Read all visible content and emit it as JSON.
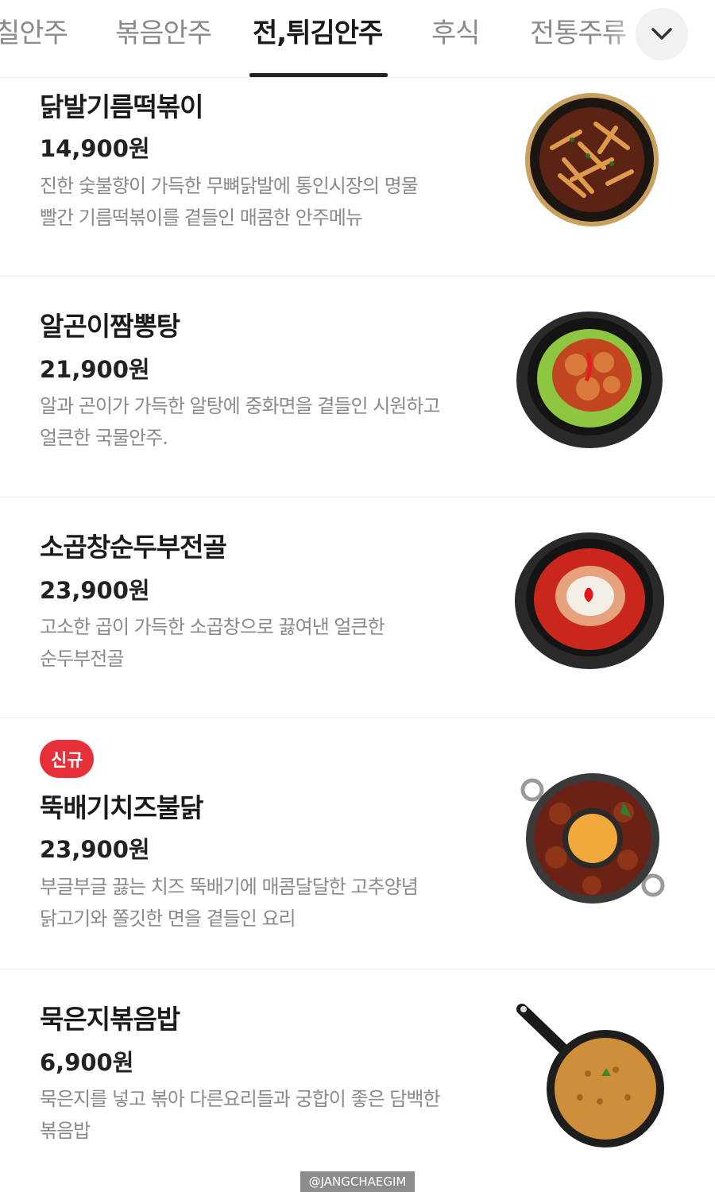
{
  "tabs": [
    {
      "label": "칠안주",
      "active": false
    },
    {
      "label": "볶음안주",
      "active": false
    },
    {
      "label": "전,튀김안주",
      "active": true
    },
    {
      "label": "후식",
      "active": false
    },
    {
      "label": "전통주류",
      "active": false
    }
  ],
  "expand_icon": "chevron-down-icon",
  "items": [
    {
      "name": "닭발기름떡볶이",
      "price": "14,900원",
      "desc_line1": "진한 숯불향이 가득한 무뼈닭발에 통인시장의 명물",
      "desc_line2": "빨간 기름떡볶이를 곁들인 매콤한 안주메뉴"
    },
    {
      "name": "알곤이짬뽕탕",
      "price": "21,900원",
      "desc_line1": "알과 곤이가 가득한 알탕에 중화면을 곁들인 시원하고",
      "desc_line2": "얼큰한 국물안주."
    },
    {
      "name": "소곱창순두부전골",
      "price": "23,900원",
      "desc_line1": "고소한 곱이 가득한 소곱창으로 끓여낸 얼큰한",
      "desc_line2": "순두부전골"
    },
    {
      "badge": "신규",
      "name": "뚝배기치즈불닭",
      "price": "23,900원",
      "desc_line1": "부글부글 끓는 치즈 뚝배기에 매콤달달한 고추양념",
      "desc_line2": "닭고기와 쫄깃한 면을 곁들인 요리"
    },
    {
      "name": "묵은지볶음밥",
      "price": "6,900원",
      "desc_line1": "묵은지를 넣고 볶아 다른요리들과 궁합이 좋은 담백한",
      "desc_line2": "볶음밥"
    }
  ],
  "watermark": "@JANGCHAEGIM",
  "colors": {
    "badge": "#e8303b",
    "tab_active": "#1a1a1a",
    "tab_inactive": "#8a8a8a",
    "desc": "#8a8a8a"
  }
}
